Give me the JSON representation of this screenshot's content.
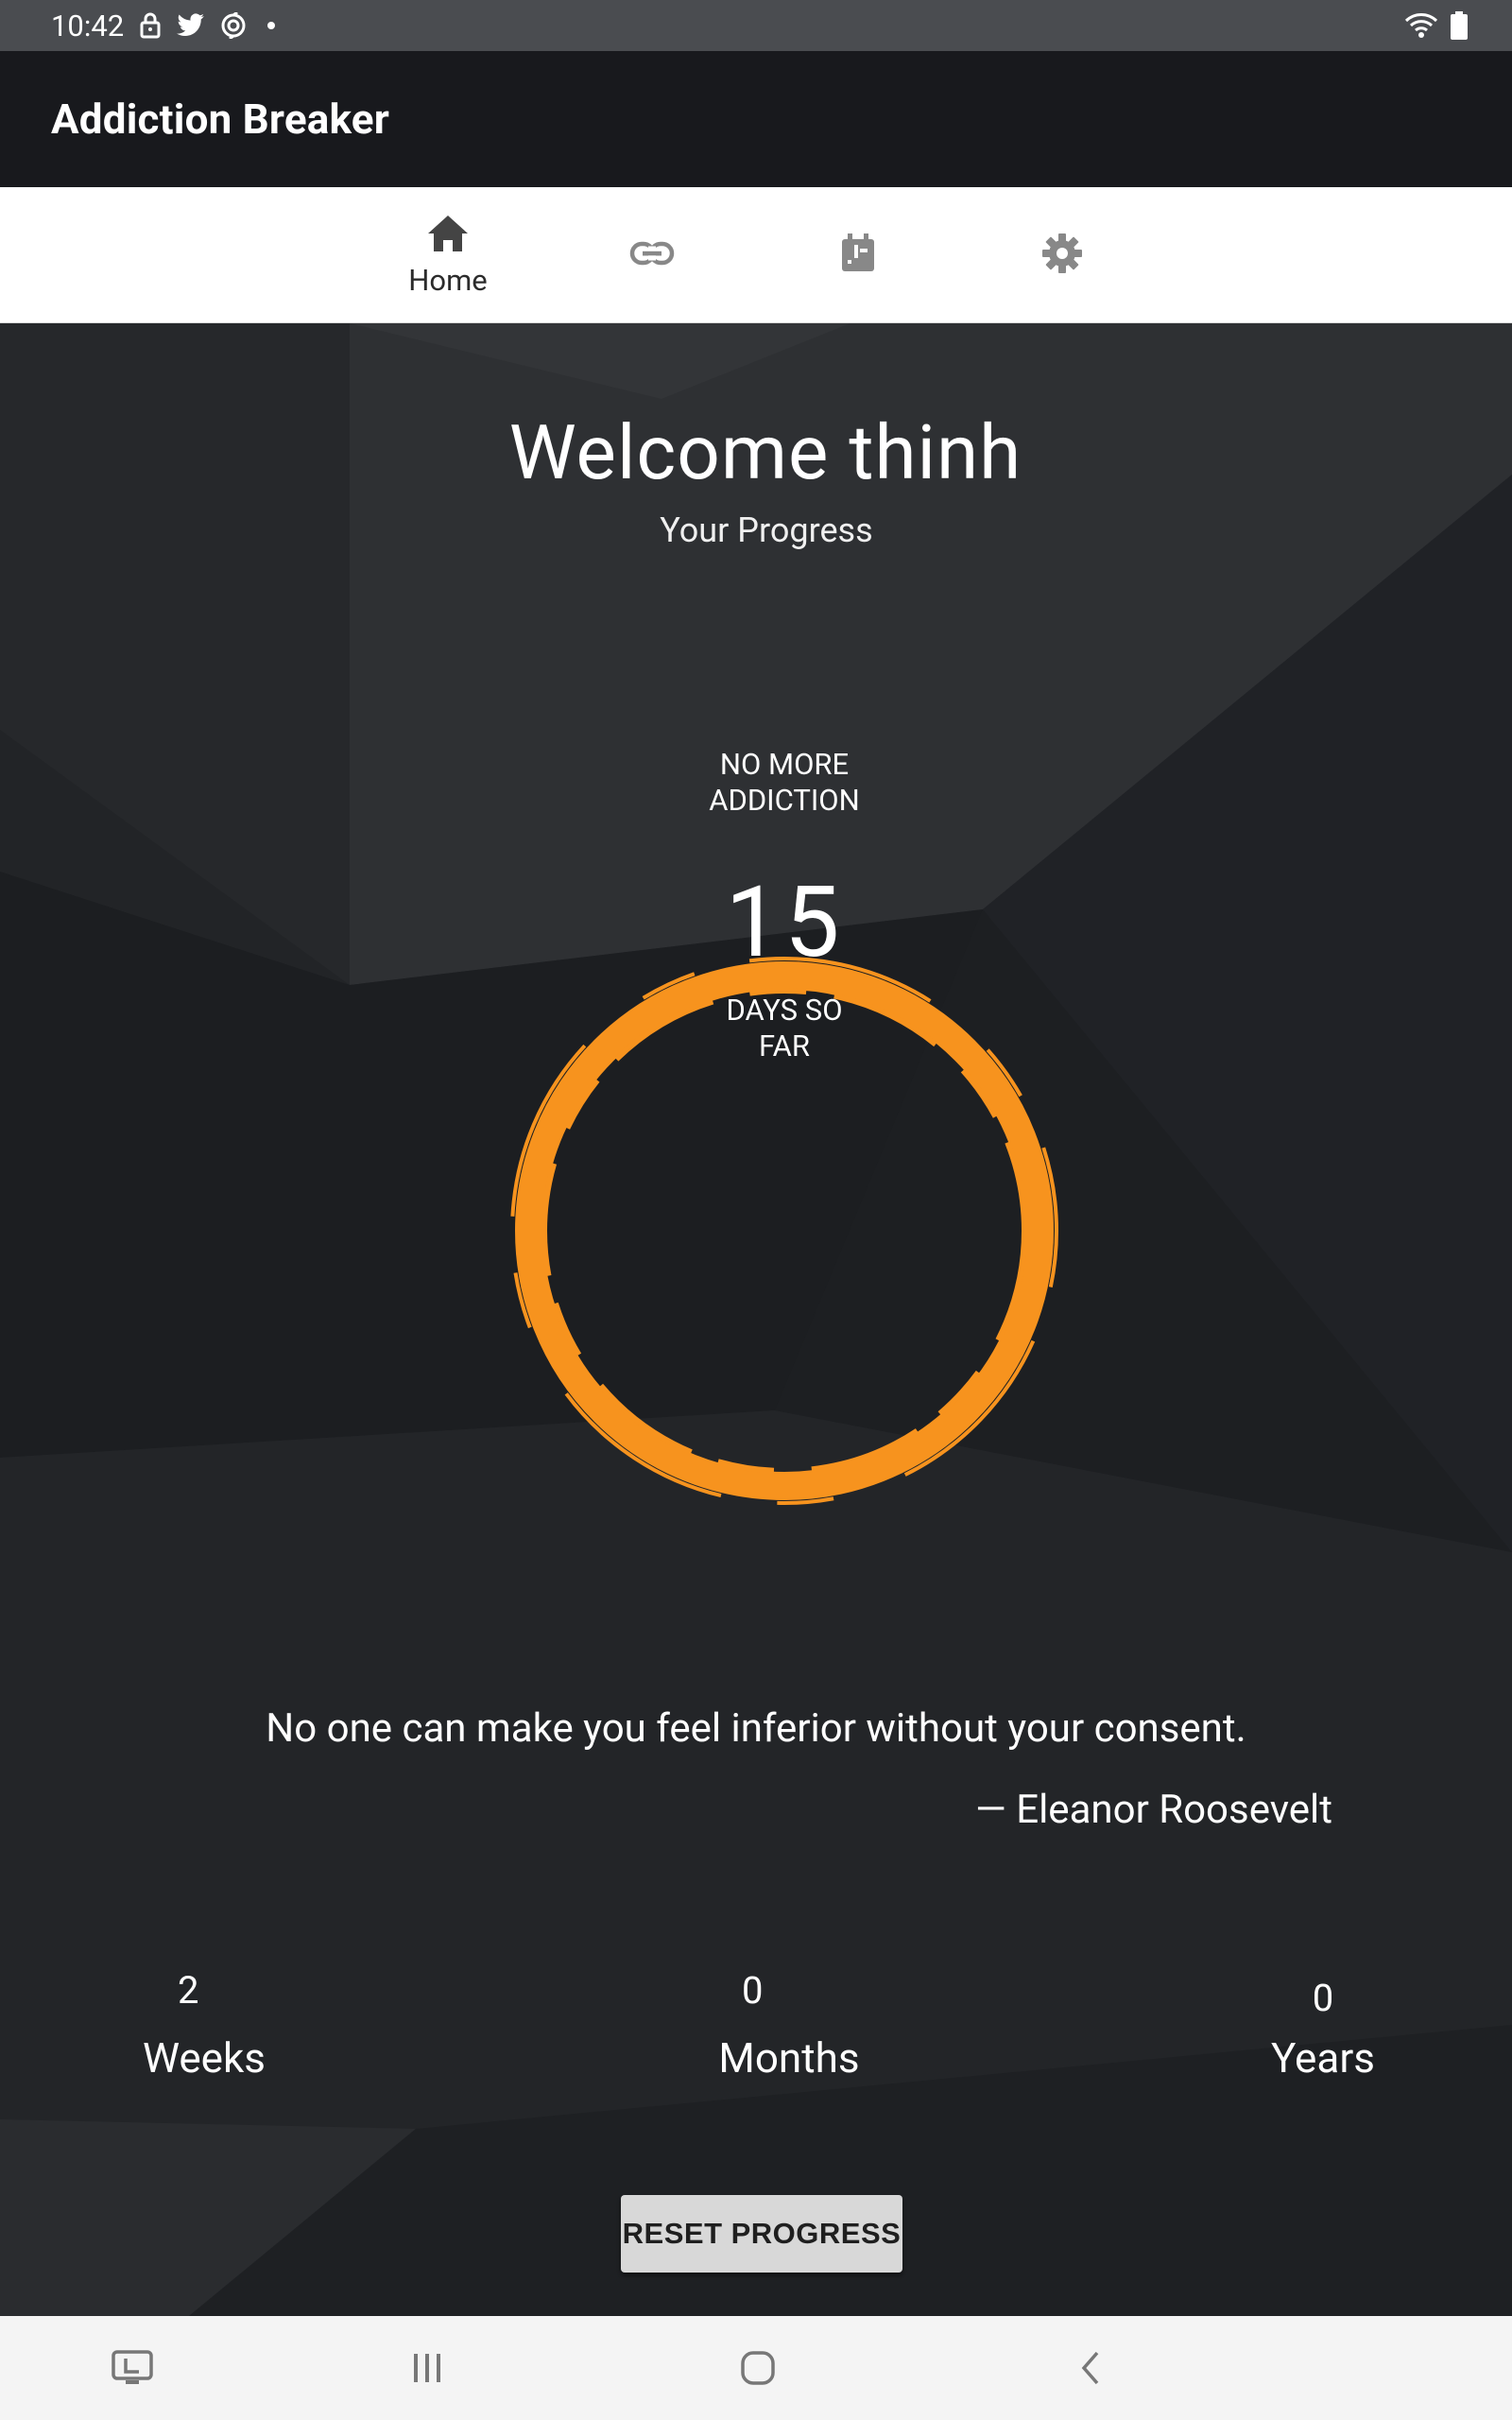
{
  "status_bar": {
    "time": "10:42",
    "icons_left": [
      "lock-icon",
      "twitter-icon",
      "sync-icon",
      "notification-dot"
    ],
    "icons_right": [
      "wifi-icon",
      "battery-icon"
    ]
  },
  "app_bar": {
    "title": "Addiction Breaker"
  },
  "tabs": [
    {
      "label": "Home",
      "icon": "home-icon",
      "active": true
    },
    {
      "label": "",
      "icon": "link-icon",
      "active": false
    },
    {
      "label": "",
      "icon": "calendar-icon",
      "active": false
    },
    {
      "label": "",
      "icon": "gear-icon",
      "active": false
    }
  ],
  "main": {
    "welcome": "Welcome thinh",
    "subtitle": "Your Progress",
    "counter": {
      "top_label": "NO MORE ADDICTION",
      "count": "15",
      "bottom_label": "DAYS SO FAR"
    },
    "quote": "No one can make you feel inferior without your consent.",
    "author": "— Eleanor Roosevelt",
    "stats": [
      {
        "value": "2",
        "label": "Weeks"
      },
      {
        "value": "0",
        "label": "Months"
      },
      {
        "value": "0",
        "label": "Years"
      }
    ],
    "reset_button": "RESET PROGRESS"
  },
  "colors": {
    "accent": "#f7931e",
    "app_bar": "#18191d",
    "status_bar": "#4a4c50",
    "background": "#232528"
  },
  "nav_bar": {
    "icons": [
      "screen-icon",
      "recents-icon",
      "home-nav-icon",
      "back-icon"
    ]
  }
}
